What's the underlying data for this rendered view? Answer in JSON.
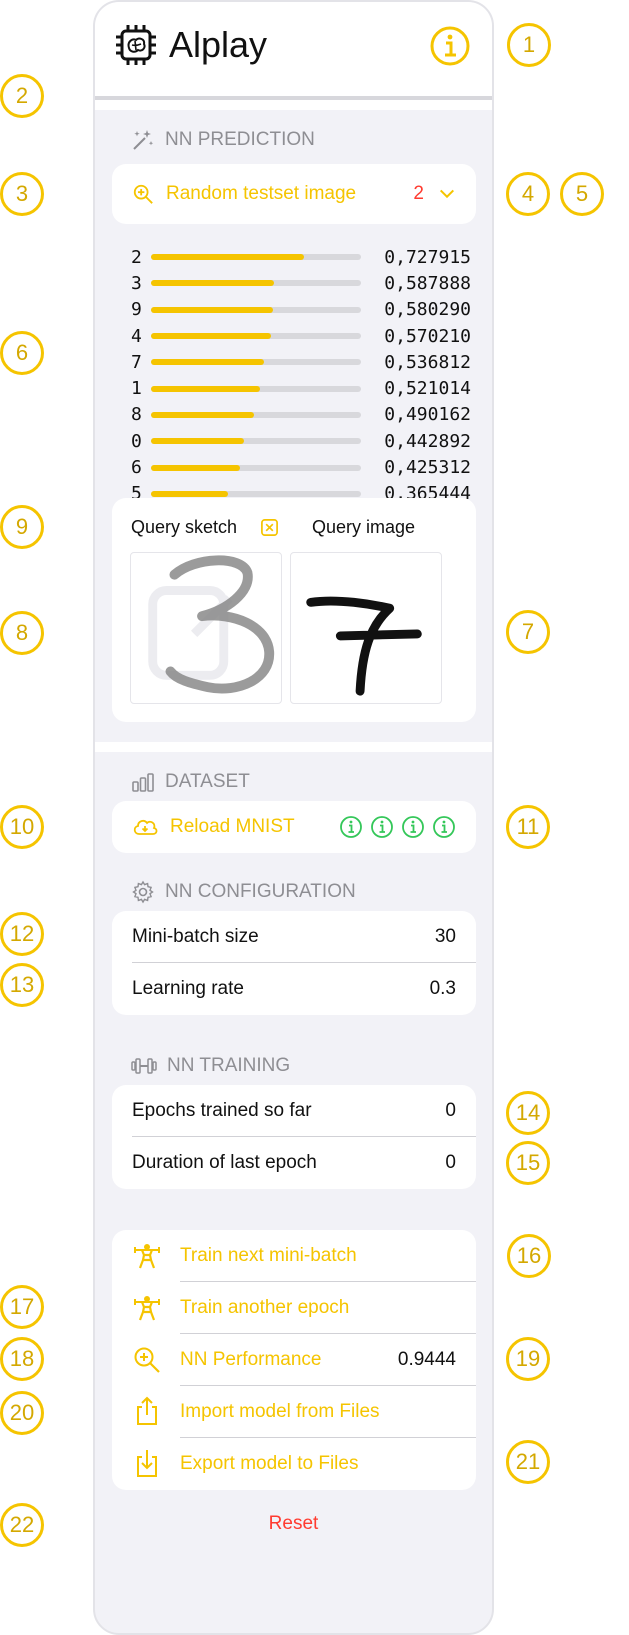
{
  "app": {
    "title": "Alplay"
  },
  "sections": {
    "prediction": "NN PREDICTION",
    "dataset": "DATASET",
    "configuration": "NN CONFIGURATION",
    "training": "NN TRAINING"
  },
  "prediction": {
    "source_label": "Random testset image",
    "predicted_digit": "2",
    "results": [
      {
        "digit": "2",
        "score": "0,727915",
        "value": 0.727915
      },
      {
        "digit": "3",
        "score": "0,587888",
        "value": 0.587888
      },
      {
        "digit": "9",
        "score": "0,580290",
        "value": 0.58029
      },
      {
        "digit": "4",
        "score": "0,570210",
        "value": 0.57021
      },
      {
        "digit": "7",
        "score": "0,536812",
        "value": 0.536812
      },
      {
        "digit": "1",
        "score": "0,521014",
        "value": 0.521014
      },
      {
        "digit": "8",
        "score": "0,490162",
        "value": 0.490162
      },
      {
        "digit": "0",
        "score": "0,442892",
        "value": 0.442892
      },
      {
        "digit": "6",
        "score": "0,425312",
        "value": 0.425312
      },
      {
        "digit": "5",
        "score": "0,365444",
        "value": 0.365444
      }
    ],
    "query_sketch_label": "Query sketch",
    "query_image_label": "Query image"
  },
  "dataset": {
    "reload_label": "Reload MNIST"
  },
  "configuration": {
    "minibatch_label": "Mini-batch size",
    "minibatch_value": "30",
    "learning_rate_label": "Learning rate",
    "learning_rate_value": "0.3"
  },
  "training": {
    "epochs_label": "Epochs trained so far",
    "epochs_value": "0",
    "duration_label": "Duration of last epoch",
    "duration_value": "0"
  },
  "actions": {
    "train_batch": "Train next mini-batch",
    "train_epoch": "Train another epoch",
    "performance": "NN Performance",
    "performance_value": "0.9444",
    "import": "Import model from Files",
    "export": "Export model to Files"
  },
  "reset_label": "Reset",
  "callouts": [
    "1",
    "2",
    "3",
    "4",
    "5",
    "6",
    "7",
    "8",
    "9",
    "10",
    "11",
    "12",
    "13",
    "14",
    "15",
    "16",
    "17",
    "18",
    "19",
    "20",
    "21",
    "22"
  ],
  "colors": {
    "accent": "#f5c400",
    "destructive": "#ff3b30",
    "info_green": "#34c759",
    "background": "#f2f2f7"
  }
}
